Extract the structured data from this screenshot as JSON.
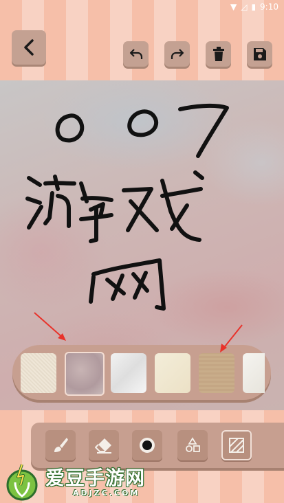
{
  "status_bar": {
    "time": "9:10",
    "icons": [
      "wifi-icon",
      "signal-off-icon",
      "battery-icon"
    ]
  },
  "toolbar": {
    "buttons": [
      {
        "name": "back-button",
        "icon": "chevron-left-icon"
      },
      {
        "name": "undo-button",
        "icon": "undo-icon"
      },
      {
        "name": "redo-button",
        "icon": "redo-icon"
      },
      {
        "name": "clear-button",
        "icon": "trash-icon"
      },
      {
        "name": "save-button",
        "icon": "floppy-disk-icon"
      }
    ]
  },
  "canvas": {
    "handwriting": "007 游戏网",
    "background": "pink-grey texture"
  },
  "paper_palette": {
    "selected_index": 1,
    "swatches": [
      "linen",
      "pink-grey",
      "white-crumpled",
      "cream",
      "kraft",
      "white"
    ]
  },
  "tools": [
    {
      "name": "brush-tool",
      "icon": "brush-icon"
    },
    {
      "name": "eraser-tool",
      "icon": "eraser-icon"
    },
    {
      "name": "pen-size-tool",
      "icon": "dot-icon"
    },
    {
      "name": "shapes-tool",
      "icon": "shapes-icon"
    },
    {
      "name": "background-tool",
      "icon": "hatch-icon"
    }
  ],
  "watermark": {
    "title": "爱豆手游网",
    "site": "ADJZC.COM"
  },
  "colors": {
    "button_bg": "#c4a192",
    "stripe_light": "#f8d2c3",
    "stripe_dark": "#f6bfa9",
    "annotation_arrow": "#e8322a"
  }
}
